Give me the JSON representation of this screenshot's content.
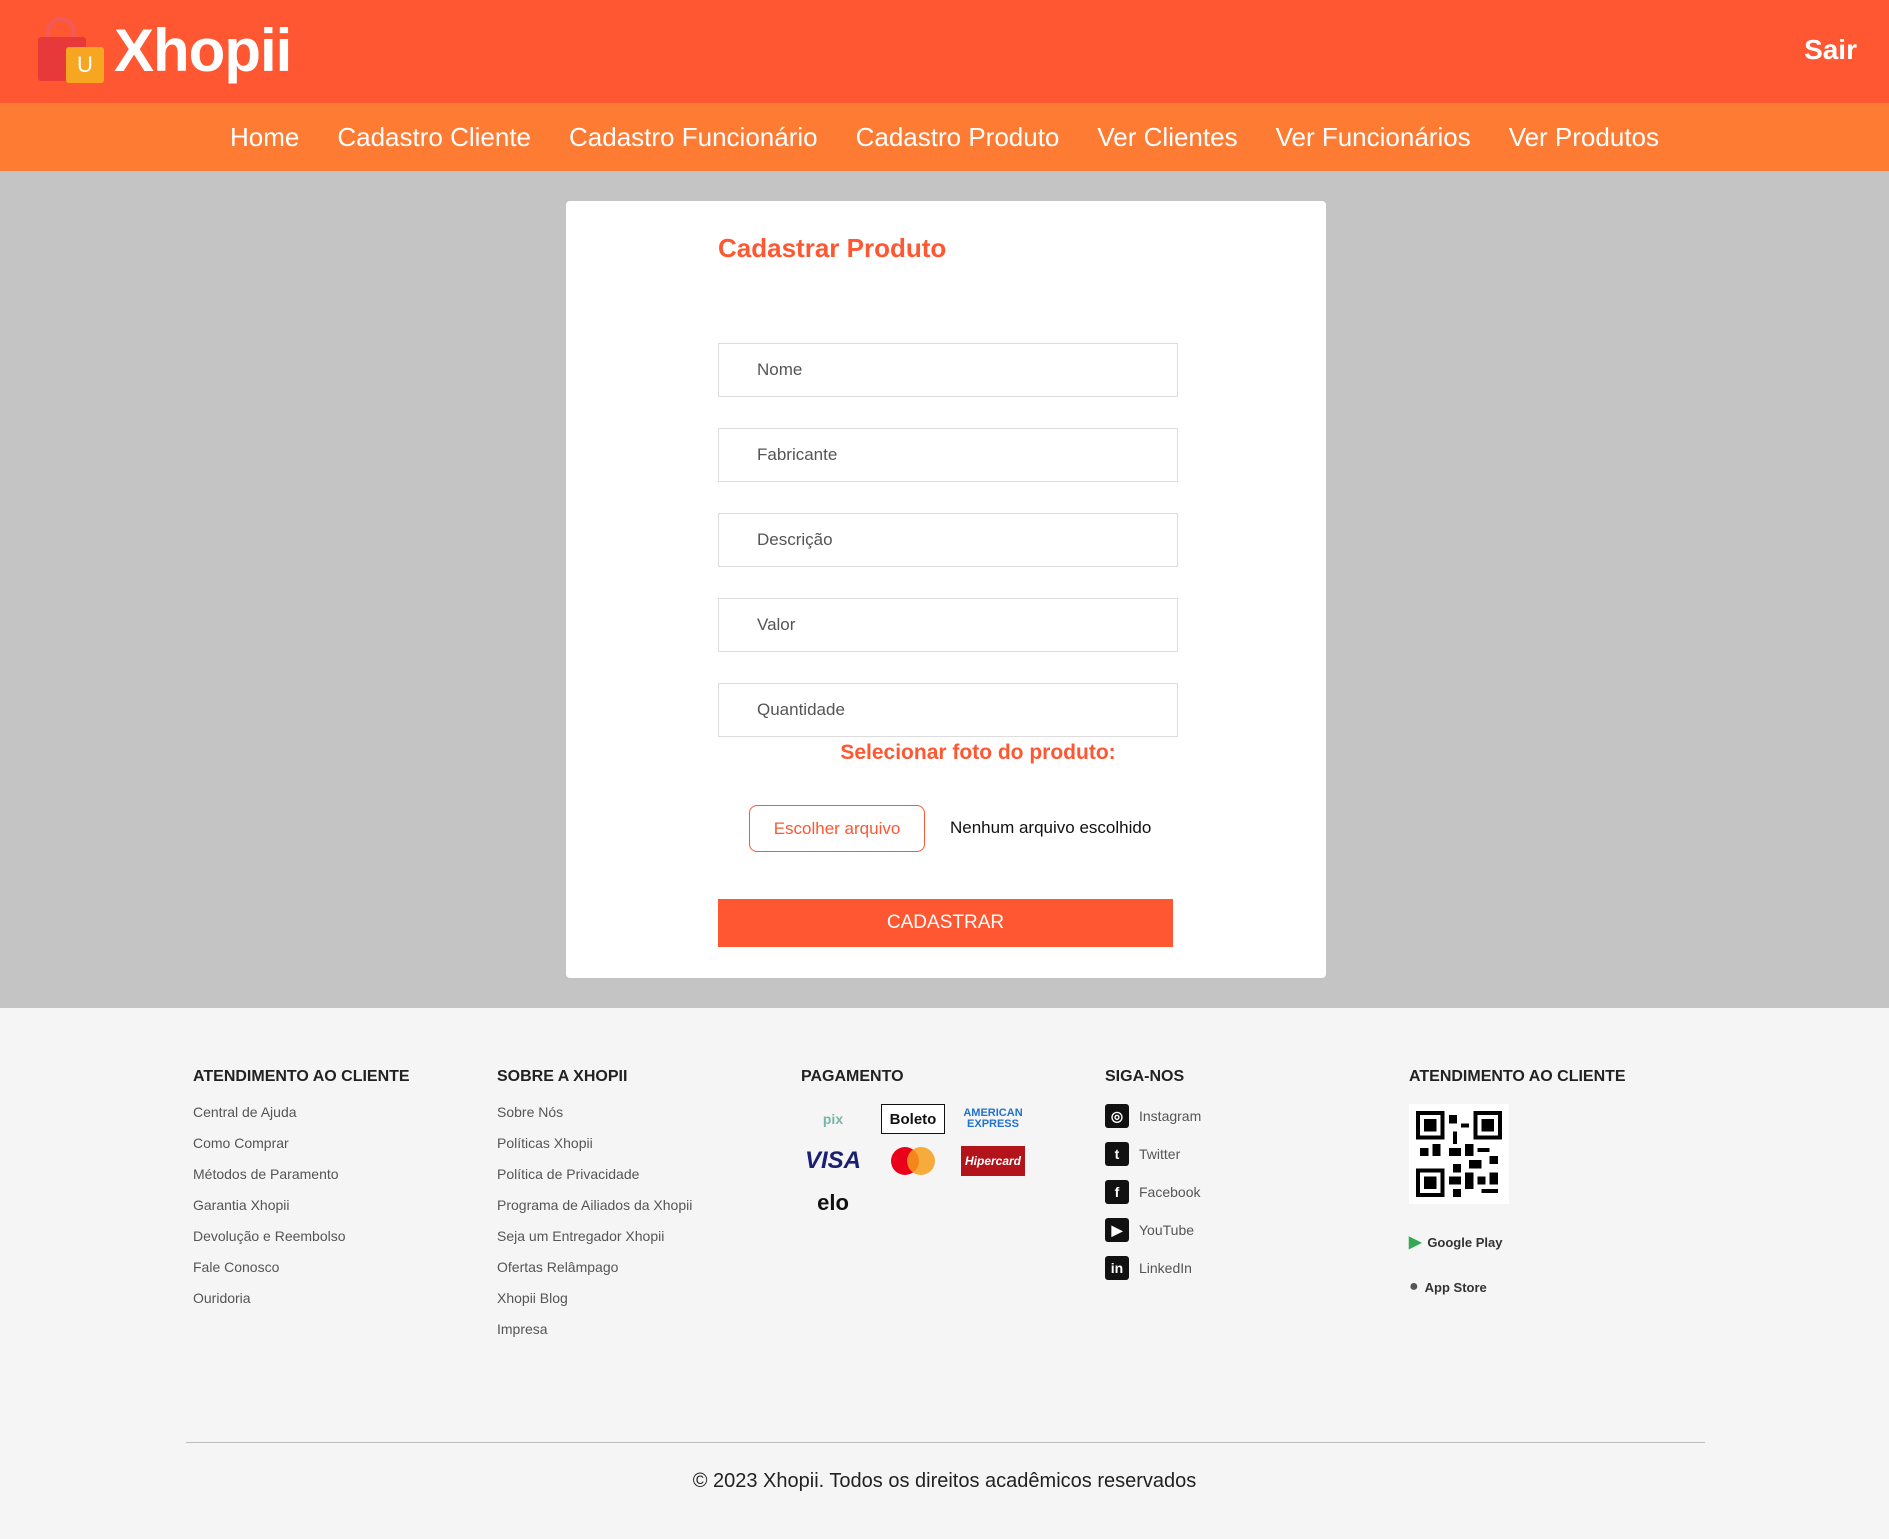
{
  "brand": {
    "name": "Xhopii",
    "bag_letter": "U"
  },
  "header": {
    "logout_label": "Sair"
  },
  "nav": {
    "items": [
      "Home",
      "Cadastro Cliente",
      "Cadastro Funcionário",
      "Cadastro Produto",
      "Ver Clientes",
      "Ver Funcionários",
      "Ver Produtos"
    ]
  },
  "form": {
    "title": "Cadastrar Produto",
    "fields": [
      {
        "placeholder": "Nome"
      },
      {
        "placeholder": "Fabricante"
      },
      {
        "placeholder": "Descrição"
      },
      {
        "placeholder": "Valor"
      },
      {
        "placeholder": "Quantidade"
      }
    ],
    "upload_label": "Selecionar foto do produto:",
    "file_button": "Escolher arquivo",
    "file_status": "Nenhum arquivo escolhido",
    "submit_label": "CADASTRAR"
  },
  "footer": {
    "customer_service": {
      "title": "ATENDIMENTO AO CLIENTE",
      "links": [
        "Central de Ajuda",
        "Como Comprar",
        "Métodos de Paramento",
        "Garantia Xhopii",
        "Devolução e Reembolso",
        "Fale Conosco",
        "Ouridoria"
      ]
    },
    "about": {
      "title": "SOBRE A XHOPII",
      "links": [
        "Sobre Nós",
        "Políticas Xhopii",
        "Política de Privacidade",
        "Programa de Ailiados da Xhopii",
        "Seja um Entregador Xhopii",
        "Ofertas Relâmpago",
        "Xhopii Blog",
        "Impresa"
      ]
    },
    "payment": {
      "title": "PAGAMENTO",
      "methods": [
        "pix",
        "Boleto",
        "AMERICAN EXPRESS",
        "VISA",
        "mastercard",
        "Hipercard",
        "elo"
      ]
    },
    "social": {
      "title": "SIGA-NOS",
      "links": [
        {
          "label": "Instagram",
          "icon": "instagram-icon"
        },
        {
          "label": "Twitter",
          "icon": "twitter-icon"
        },
        {
          "label": "Facebook",
          "icon": "facebook-icon"
        },
        {
          "label": "YouTube",
          "icon": "youtube-icon"
        },
        {
          "label": "LinkedIn",
          "icon": "linkedin-icon"
        }
      ]
    },
    "apps": {
      "title": "ATENDIMENTO AO CLIENTE",
      "stores": [
        "Google Play",
        "App Store"
      ]
    },
    "copyright": "© 2023 Xhopii. Todos os direitos acadêmicos reservados"
  },
  "colors": {
    "primary": "#fe5731",
    "nav": "#fe7b33",
    "main_bg": "#c4c4c4",
    "footer_bg": "#f5f5f5"
  }
}
